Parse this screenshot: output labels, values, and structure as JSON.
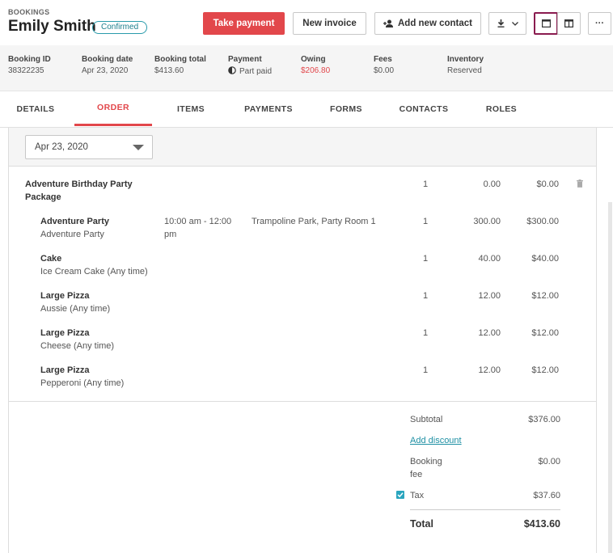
{
  "header": {
    "breadcrumb": "BOOKINGS",
    "customer_name": "Emily Smith",
    "status": "Confirmed",
    "buttons": {
      "take_payment": "Take payment",
      "new_invoice": "New invoice",
      "add_contact": "Add new contact",
      "more": "···"
    }
  },
  "summary": [
    {
      "label": "Booking ID",
      "value": "38322235"
    },
    {
      "label": "Booking date",
      "value": "Apr 23, 2020"
    },
    {
      "label": "Booking total",
      "value": "$413.60"
    },
    {
      "label": "Payment",
      "value": "Part paid"
    },
    {
      "label": "Owing",
      "value": "$206.80"
    },
    {
      "label": "Fees",
      "value": "$0.00"
    },
    {
      "label": "Inventory",
      "value": "Reserved"
    }
  ],
  "tabs": [
    "DETAILS",
    "ORDER",
    "ITEMS",
    "PAYMENTS",
    "FORMS",
    "CONTACTS",
    "ROLES"
  ],
  "active_tab": "ORDER",
  "date_filter": "Apr 23, 2020",
  "package": {
    "name_line1": "Adventure Birthday Party",
    "name_line2": "Package",
    "qty": "1",
    "price": "0.00",
    "total": "$0.00"
  },
  "items": [
    {
      "name": "Adventure Party",
      "detail": "Adventure Party",
      "time_line1": "10:00 am - 12:00",
      "time_line2": "pm",
      "location": "Trampoline Park, Party Room 1",
      "qty": "1",
      "price": "300.00",
      "total": "$300.00"
    },
    {
      "name": "Cake",
      "detail": "Ice Cream Cake (Any time)",
      "time_line1": "",
      "time_line2": "",
      "location": "",
      "qty": "1",
      "price": "40.00",
      "total": "$40.00"
    },
    {
      "name": "Large Pizza",
      "detail": "Aussie (Any time)",
      "time_line1": "",
      "time_line2": "",
      "location": "",
      "qty": "1",
      "price": "12.00",
      "total": "$12.00"
    },
    {
      "name": "Large Pizza",
      "detail": "Cheese (Any time)",
      "time_line1": "",
      "time_line2": "",
      "location": "",
      "qty": "1",
      "price": "12.00",
      "total": "$12.00"
    },
    {
      "name": "Large Pizza",
      "detail": "Pepperoni (Any time)",
      "time_line1": "",
      "time_line2": "",
      "location": "",
      "qty": "1",
      "price": "12.00",
      "total": "$12.00"
    }
  ],
  "totals": {
    "subtotal_label": "Subtotal",
    "subtotal": "$376.00",
    "add_discount": "Add discount",
    "booking_fee_line1": "Booking",
    "booking_fee_line2": "fee",
    "booking_fee": "$0.00",
    "tax_label": "Tax",
    "tax": "$37.60",
    "tax_checked": true,
    "total_label": "Total",
    "total": "$413.60"
  },
  "colors": {
    "accent": "#e2474b",
    "link": "#1d8fa3",
    "active_view_border": "#8a1b4f"
  }
}
